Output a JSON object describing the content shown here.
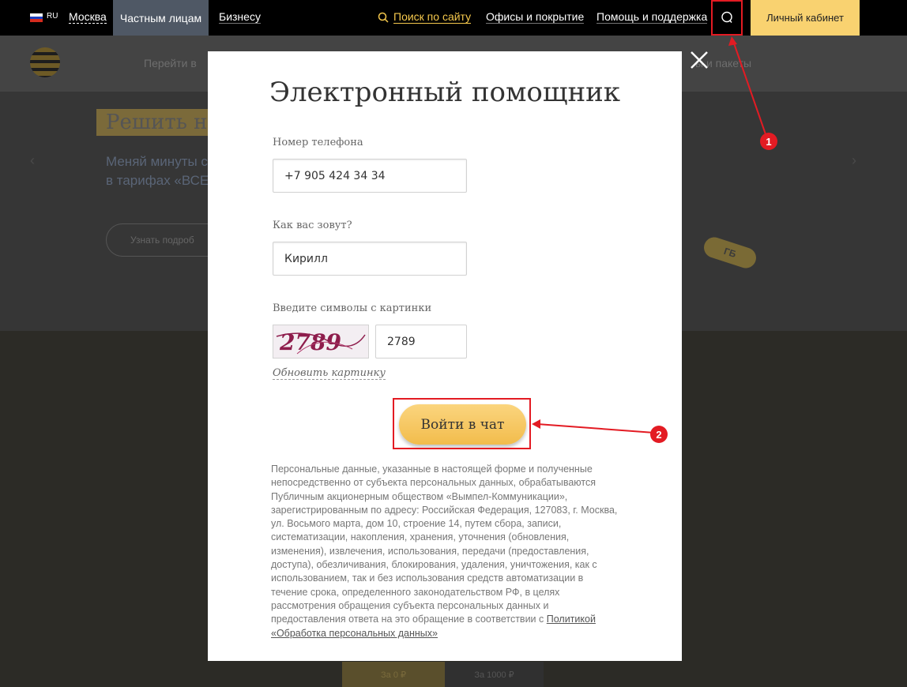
{
  "topbar": {
    "lang": "RU",
    "city": "Москва",
    "tab_private": "Частным лицам",
    "tab_business": "Бизнесу",
    "search_label": "Поиск по сайту",
    "offices": "Офисы и покрытие",
    "help": "Помощь и поддержка",
    "cabinet": "Личный кабинет"
  },
  "background": {
    "subnav_1": "Перейти в",
    "subnav_2": "ы и пакеты",
    "hero_title": "Решить н",
    "hero_sub_1": "Меняй минуты с",
    "hero_sub_2": "в тарифах «ВСЕ",
    "hero_btn": "Узнать подроб",
    "gb_tag": "ГБ",
    "chip_1": "За 0 ₽",
    "chip_2": "За 1000 ₽"
  },
  "modal": {
    "title": "Электронный помощник",
    "phone_label": "Номер телефона",
    "phone_value": "+7 905 424 34 34",
    "name_label": "Как вас зовут?",
    "name_value": "Кирилл",
    "captcha_label": "Введите символы с картинки",
    "captcha_image_text": "2789",
    "captcha_value": "2789",
    "refresh_label": "Обновить картинку",
    "submit_label": "Войти в чат",
    "legal_text": "Персональные данные, указанные в настоящей форме и полученные непосредственно от субъекта персональных данных, обрабатываются Публичным акционерным обществом «Вымпел-Коммуникации», зарегистрированным по адресу: Российская Федерация, 127083, г. Москва, ул. Восьмого марта, дом 10, строение 14, путем сбора, записи, систематизации, накопления, хранения, уточнения (обновления, изменения), извлечения, использования, передачи (предоставления, доступа), обезличивания, блокирования, удаления, уничтожения, как с использованием, так и без использования средств автоматизации в течение срока, определенного законодательством РФ, в целях рассмотрения обращения субъекта персональных данных и предоставления ответа на это обращение в соответствии с ",
    "legal_link": "Политикой «Обработка персональных данных»"
  },
  "annotations": {
    "badge_1": "1",
    "badge_2": "2",
    "color": "#e31b23"
  },
  "colors": {
    "brand_yellow": "#f9d270",
    "search_yellow": "#f5c84c",
    "active_tab": "#4f5865"
  }
}
